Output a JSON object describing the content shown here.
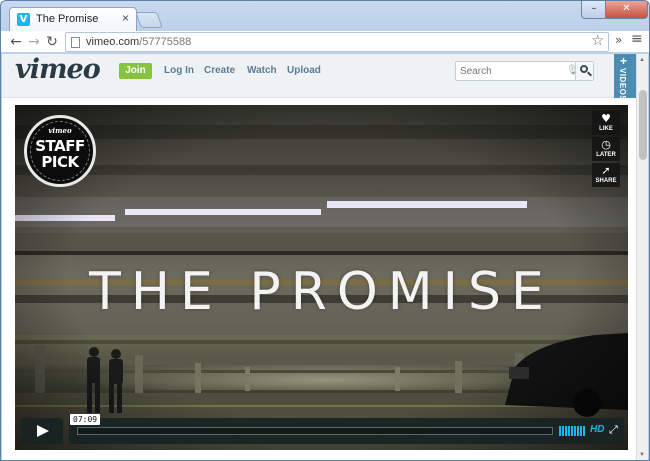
{
  "browser": {
    "tab_title": "The Promise",
    "tab_close": "×",
    "favicon_letter": "V",
    "url_host": "vimeo.com",
    "url_path": "/57775588",
    "window_buttons": {
      "minimize": "–",
      "maximize": "□",
      "close": "✕"
    },
    "nav_icons": {
      "back": "←",
      "forward": "→",
      "reload": "↻",
      "star": "☆",
      "extensions": "»",
      "menu": "≡"
    }
  },
  "vimeo": {
    "logo": "vimeo",
    "join_label": "Join",
    "nav": [
      "Log In",
      "Create",
      "Watch",
      "Upload"
    ],
    "search_placeholder": "Search",
    "videos_tab_plus": "+",
    "videos_tab_label": "VIDEOS"
  },
  "player": {
    "title_overlay": "THE PROMISE",
    "badge": {
      "brand": "vimeo",
      "line1": "STAFF",
      "line2": "PICK"
    },
    "side_actions": [
      {
        "icon": "♥",
        "label": "LIKE"
      },
      {
        "icon": "◷",
        "label": "LATER"
      },
      {
        "icon": "➚",
        "label": "SHARE"
      }
    ],
    "timecode": "07:09",
    "progress": 0.0,
    "hd_label": "HD",
    "fullscreen_icon": "⤢"
  },
  "colors": {
    "vimeo_blue": "#1ab7ea",
    "join_green": "#86c43d",
    "logo_dark": "#2a3b45",
    "nav_text": "#5b7d93"
  }
}
